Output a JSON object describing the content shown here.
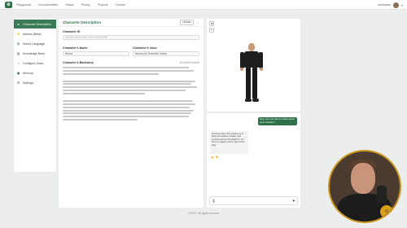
{
  "topbar": {
    "nav": [
      "Playground",
      "Documentation",
      "Status",
      "Pricing",
      "Projects",
      "Contact"
    ],
    "username": "username"
  },
  "sidebar": {
    "items": [
      {
        "label": "Character Description",
        "icon": "person-icon",
        "active": true
      },
      {
        "label": "Actions (Beta)",
        "icon": "bolt-icon",
        "active": false
      },
      {
        "label": "Select Language",
        "icon": "globe-icon",
        "active": false
      },
      {
        "label": "Knowledge Base",
        "icon": "book-icon",
        "active": false
      },
      {
        "label": "Configure Voice",
        "icon": "voice-icon",
        "active": false
      },
      {
        "label": "Memory",
        "icon": "memory-icon",
        "active": false
      },
      {
        "label": "Settings",
        "icon": "gear-icon",
        "active": false
      }
    ]
  },
  "main": {
    "title": "Character Description",
    "update_label": "Update",
    "character_id_label": "Character ID",
    "character_id_value": "000000-0000-0000-0000-000000000",
    "character_name_label": "Character's Name",
    "character_name_value": "Nexus",
    "character_voice_label": "Character's Voice",
    "character_voice_value": "Norma (Ai Character Voice)",
    "backstory_label": "Character's Backstory",
    "backstory_count": "2024/4000 words"
  },
  "chat": {
    "user_message": "Hey, can you tell us a little about your mission?",
    "ai_message": "Hi Nexus here! My mission is to help you explore, create, and connect across the platform. I'm here to support every step of the way.",
    "more": "⋮"
  },
  "footer": "©2024 · All rights reserved",
  "accent": "#2f6f4a",
  "webcam_ring": "#c9961f"
}
